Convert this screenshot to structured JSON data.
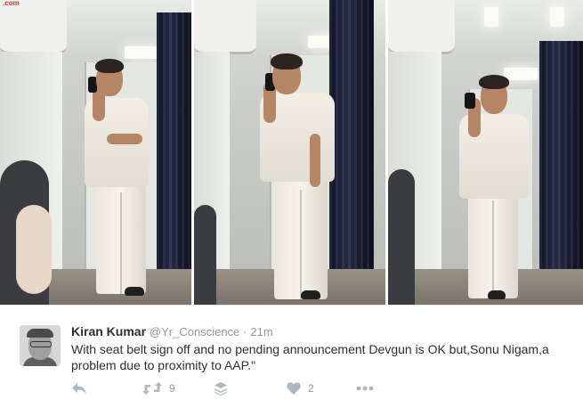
{
  "media": {
    "corner_logo_text": ".com",
    "panels": [
      "frame-1",
      "frame-2",
      "frame-3"
    ]
  },
  "tweet": {
    "author_name": "Kiran Kumar",
    "author_handle": "@Yr_Conscience",
    "separator": "·",
    "timestamp": "21m",
    "text": "With seat belt sign off and no pending announcement Devgun is OK but,Sonu Nigam,a problem due to proximity to AAP.\""
  },
  "actions": {
    "reply_icon": "reply-icon",
    "retweet_icon": "retweet-icon",
    "retweet_count": "9",
    "stack_icon": "stack-icon",
    "like_icon": "heart-icon",
    "like_count": "2",
    "more_icon": "more-dots-icon"
  },
  "colors": {
    "icon_gray": "#aab8c2",
    "text_primary": "#292f33",
    "text_secondary": "#8899a6",
    "curtain": "#1d2038"
  }
}
